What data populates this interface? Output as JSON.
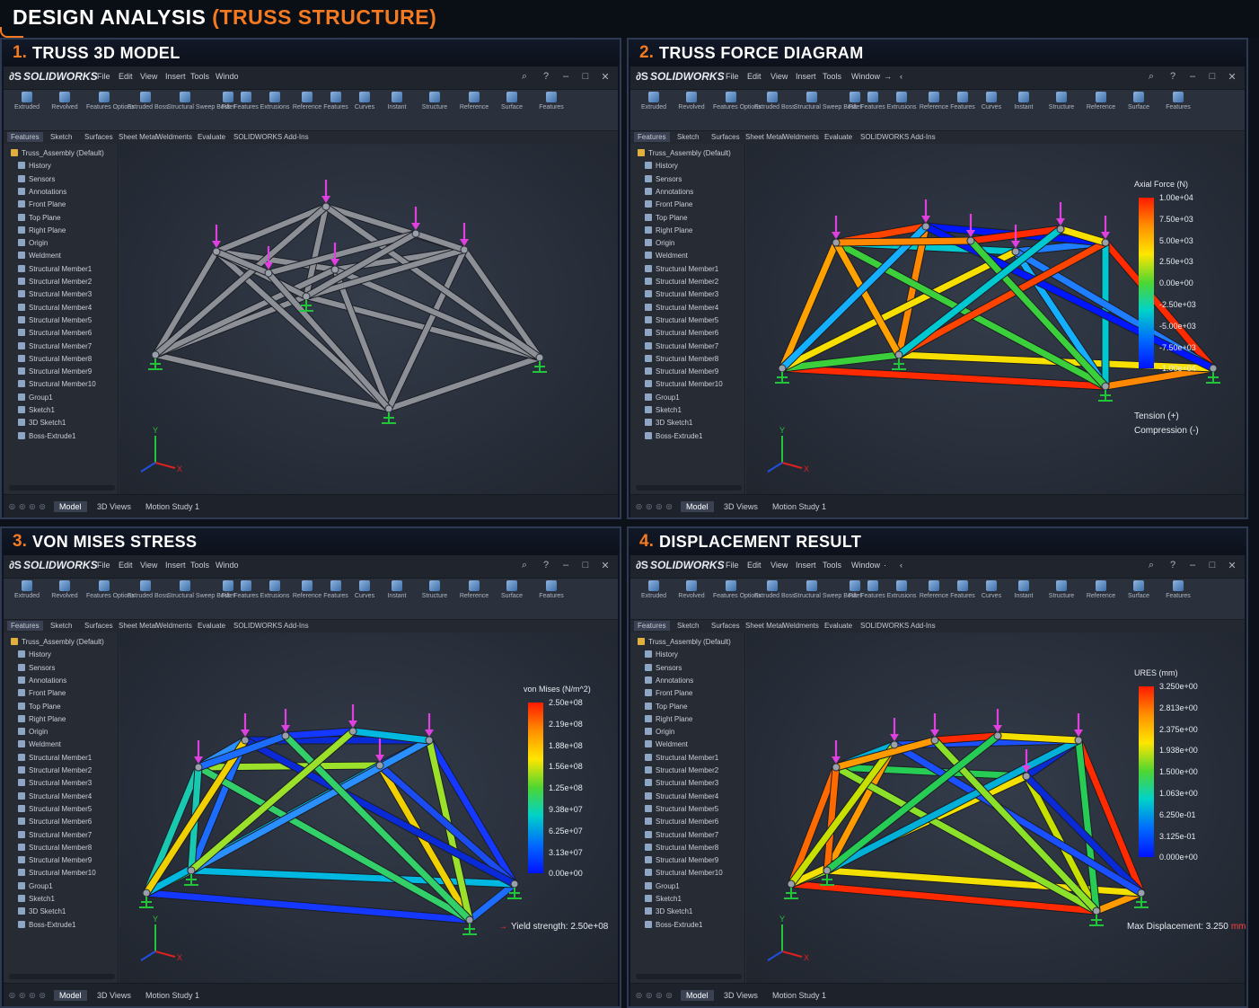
{
  "page": {
    "title_white": "DESIGN ANALYSIS ",
    "title_orange": "(TRUSS STRUCTURE)"
  },
  "colors": {
    "accent_orange": "#f47a22",
    "load_arrow": "#e040e0",
    "fixture": "#22c43a",
    "gray_member": "#8c8f96"
  },
  "quadrants": [
    {
      "number": "1.",
      "title": "TRUSS 3D MODEL",
      "menu": [
        "File",
        "Edit",
        "View",
        "Insert",
        "Tools",
        "Windo"
      ],
      "legend": null
    },
    {
      "number": "2.",
      "title": "TRUSS FORCE DIAGRAM",
      "menu": [
        "File",
        "Edit",
        "View",
        "Insert",
        "Tools",
        "Window",
        "→",
        "‹"
      ],
      "legend": {
        "title": "Axial Force (N)",
        "ticks": [
          "1.00e+04",
          "7.50e+03",
          "5.00e+03",
          "2.50e+03",
          "0.00e+00",
          "-2.50e+03",
          "-5.00e+03",
          "-7.50e+03",
          "-1.00e+04"
        ],
        "notes": [
          "Tension (+)",
          "Compression (-)"
        ]
      }
    },
    {
      "number": "3.",
      "title": "VON MISES STRESS",
      "menu": [
        "File",
        "Edit",
        "View",
        "Insert",
        "Tools",
        "Windo"
      ],
      "legend": {
        "title": "von Mises (N/m^2)",
        "ticks": [
          "2.50e+08",
          "2.19e+08",
          "1.88e+08",
          "1.56e+08",
          "1.25e+08",
          "9.38e+07",
          "6.25e+07",
          "3.13e+07",
          "0.00e+00"
        ],
        "notes": [
          "Yield strength: 2.50e+08"
        ]
      }
    },
    {
      "number": "4.",
      "title": "DISPLACEMENT RESULT",
      "menu": [
        "File",
        "Edit",
        "View",
        "Insert",
        "Tools",
        "Window",
        "·",
        "‹"
      ],
      "legend": {
        "title": "URES (mm)",
        "ticks": [
          "3.250e+00",
          "2.813e+00",
          "2.375e+00",
          "1.938e+00",
          "1.500e+00",
          "1.063e+00",
          "6.250e-01",
          "3.125e-01",
          "0.000e+00"
        ],
        "notes": [
          "Max Displacement: 3.250",
          "mm"
        ]
      }
    }
  ],
  "app": {
    "logo": "SOLIDWORKS",
    "toolbar": [
      "Extruded",
      "Revolved",
      "Features Options",
      "Extruded Boss",
      "Structural Sweep Boss",
      "Fillet",
      "Features",
      "Extrusions",
      "Reference",
      "Features",
      "Curves",
      "Instant",
      "Structure",
      "Reference",
      "Surface",
      "Features",
      "Instant",
      "Structure",
      "Sweeps"
    ],
    "tabs": [
      "Features",
      "Sketch",
      "Surfaces",
      "Sheet Metal",
      "Weldments",
      "Evaluate",
      "SOLIDWORKS Add-Ins"
    ],
    "tree": [
      "Truss_Assembly  (Default)",
      "History",
      "Sensors",
      "Annotations",
      "Front Plane",
      "Top Plane",
      "Right Plane",
      "Origin",
      "Weldment",
      "Structural Member1",
      "Structural Member2",
      "Structural Member3",
      "Structural Member4",
      "Structural Member5",
      "Structural Member6",
      "Structural Member7",
      "Structural Member8",
      "Structural Member9",
      "Structural Member10",
      "Group1",
      "Sketch1",
      "3D Sketch1",
      "Boss-Extrude1"
    ],
    "bottom_tabs": [
      "Model",
      "3D Views",
      "Motion Study 1"
    ],
    "bottom_nav": "◎ ◎ ◎ ◎"
  }
}
